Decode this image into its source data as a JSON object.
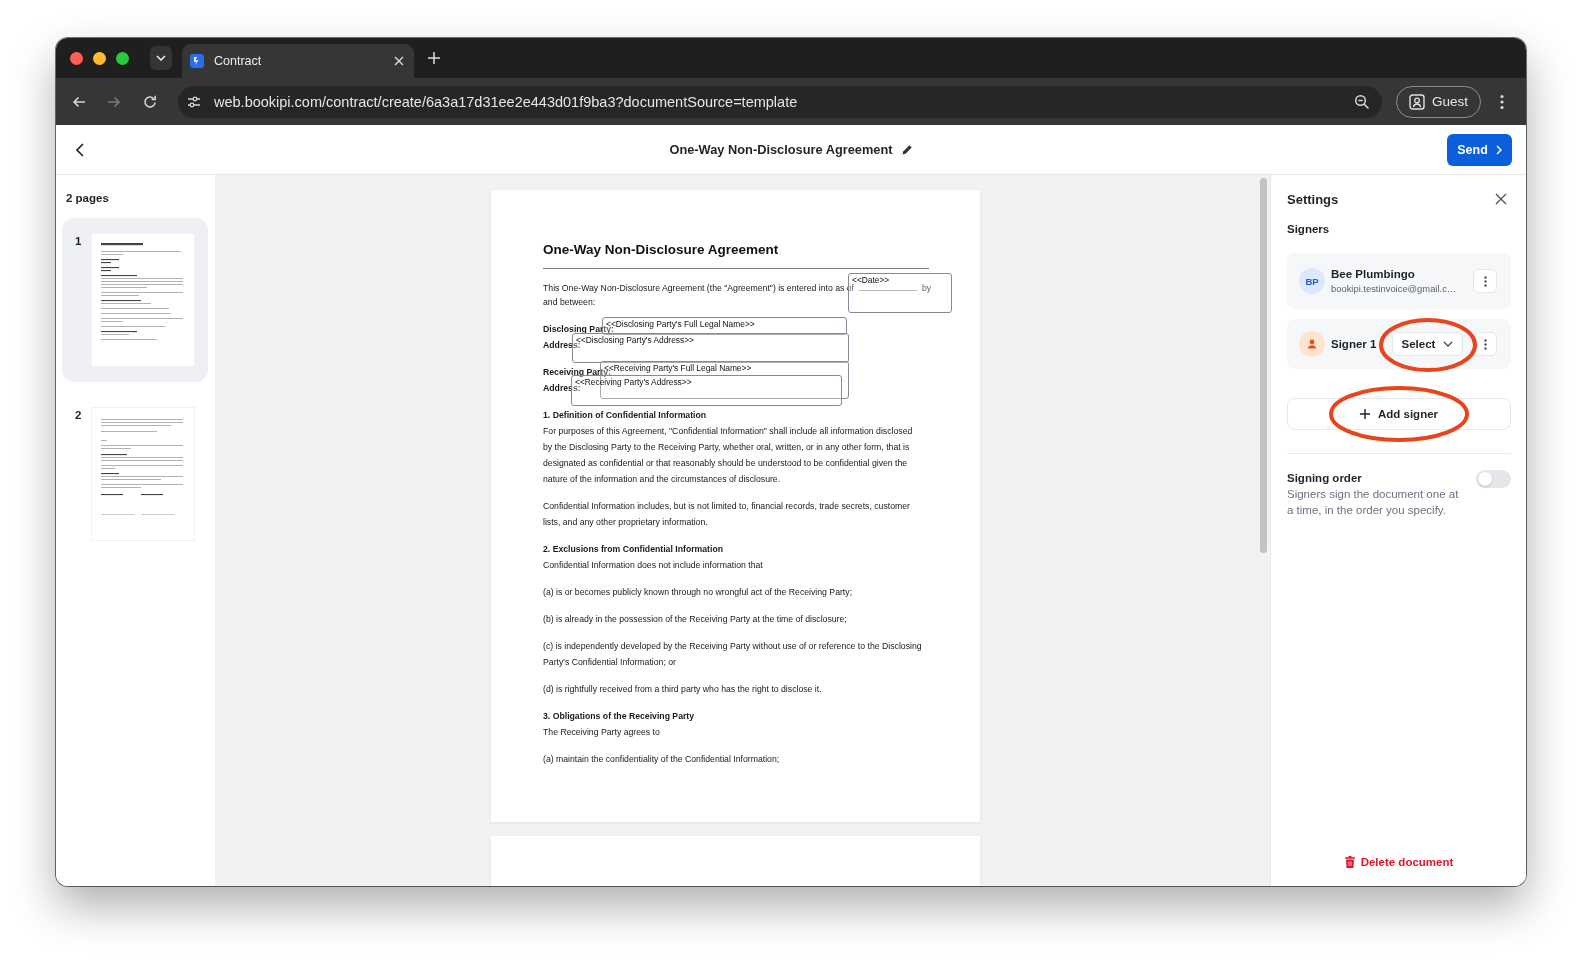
{
  "browser": {
    "tabs": [
      {
        "title": "Contract",
        "selected": true
      }
    ],
    "forward_disabled": true,
    "url": "web.bookipi.com/contract/create/6a3a17d31ee2e443d01f9ba3?documentSource=template",
    "profile": "Guest"
  },
  "header": {
    "title": "One-Way Non-Disclosure Agreement",
    "send": "Send"
  },
  "pages_panel": {
    "title": "2 pages",
    "pages": [
      {
        "number": "1",
        "selected": true
      },
      {
        "number": "2",
        "selected": false
      }
    ]
  },
  "document": {
    "title": "One-Way Non-Disclosure Agreement",
    "intro": {
      "start": "This One-Way Non-Disclosure Agreement (the \"Agreement\") is entered into as of",
      "after_blank": "by",
      "next_line": "and between:"
    },
    "parties": [
      {
        "lines": [
          "Disclosing Party:",
          "Address:"
        ]
      },
      {
        "lines": [
          "Receiving Party:",
          "Address:"
        ]
      }
    ],
    "fields": [
      {
        "text": "<<Date>>"
      },
      {
        "text": "<<Disclosing Party's Full Legal Name>>"
      },
      {
        "text": "<<Disclosing Party's Address>>"
      },
      {
        "text": "<<Receiving Party's Full Legal Name>>"
      },
      {
        "text": "<<Receiving Party's Address>>"
      }
    ],
    "blocks": [
      {
        "kind": "heading",
        "text": "1. Definition of Confidential Information"
      },
      {
        "kind": "paragraph",
        "text": "For purposes of this Agreement, \"Confidential Information\" shall include all information disclosed by the Disclosing Party to the Receiving Party, whether oral, written, or in any other form, that is designated as confidential or that reasonably should be understood to be confidential given the nature of the information and the circumstances of disclosure."
      },
      {
        "kind": "paragraph",
        "text": "Confidential Information includes, but is not limited to, financial records, trade secrets, customer lists, and any other proprietary information."
      },
      {
        "kind": "heading",
        "text": "2. Exclusions from Confidential Information"
      },
      {
        "kind": "paragraph",
        "text": "Confidential Information does not include information that"
      },
      {
        "kind": "paragraph",
        "text": "(a) is or becomes publicly known through no wrongful act of the Receiving Party;"
      },
      {
        "kind": "paragraph",
        "text": "(b) is already in the possession of the Receiving Party at the time of disclosure;"
      },
      {
        "kind": "paragraph",
        "text": "(c) is independently developed by the Receiving Party without use of or reference to the Disclosing Party's Confidential Information; or"
      },
      {
        "kind": "paragraph",
        "text": "(d) is rightfully received from a third party who has the right to disclose it."
      },
      {
        "kind": "heading",
        "text": "3. Obligations of the Receiving Party"
      },
      {
        "kind": "paragraph",
        "text": "The Receiving Party agrees to"
      },
      {
        "kind": "paragraph",
        "text": "(a) maintain the confidentiality of the Confidential Information;"
      }
    ]
  },
  "settings": {
    "title": "Settings",
    "section": "Signers",
    "signers": [
      {
        "kind": "contact",
        "initials": "BP",
        "name": "Bee Plumbingo",
        "email": "bookipi.testinvoice@gmail.c…"
      },
      {
        "kind": "placeholder",
        "name": "Signer 1",
        "select": {
          "label": "Select",
          "highlighted": true
        }
      }
    ],
    "add_signer": {
      "label": "Add signer",
      "highlighted": true
    },
    "signing_order": {
      "title": "Signing order",
      "description": "Signers sign the document one at a time, in the order you specify.",
      "on": false
    },
    "delete": "Delete document"
  }
}
